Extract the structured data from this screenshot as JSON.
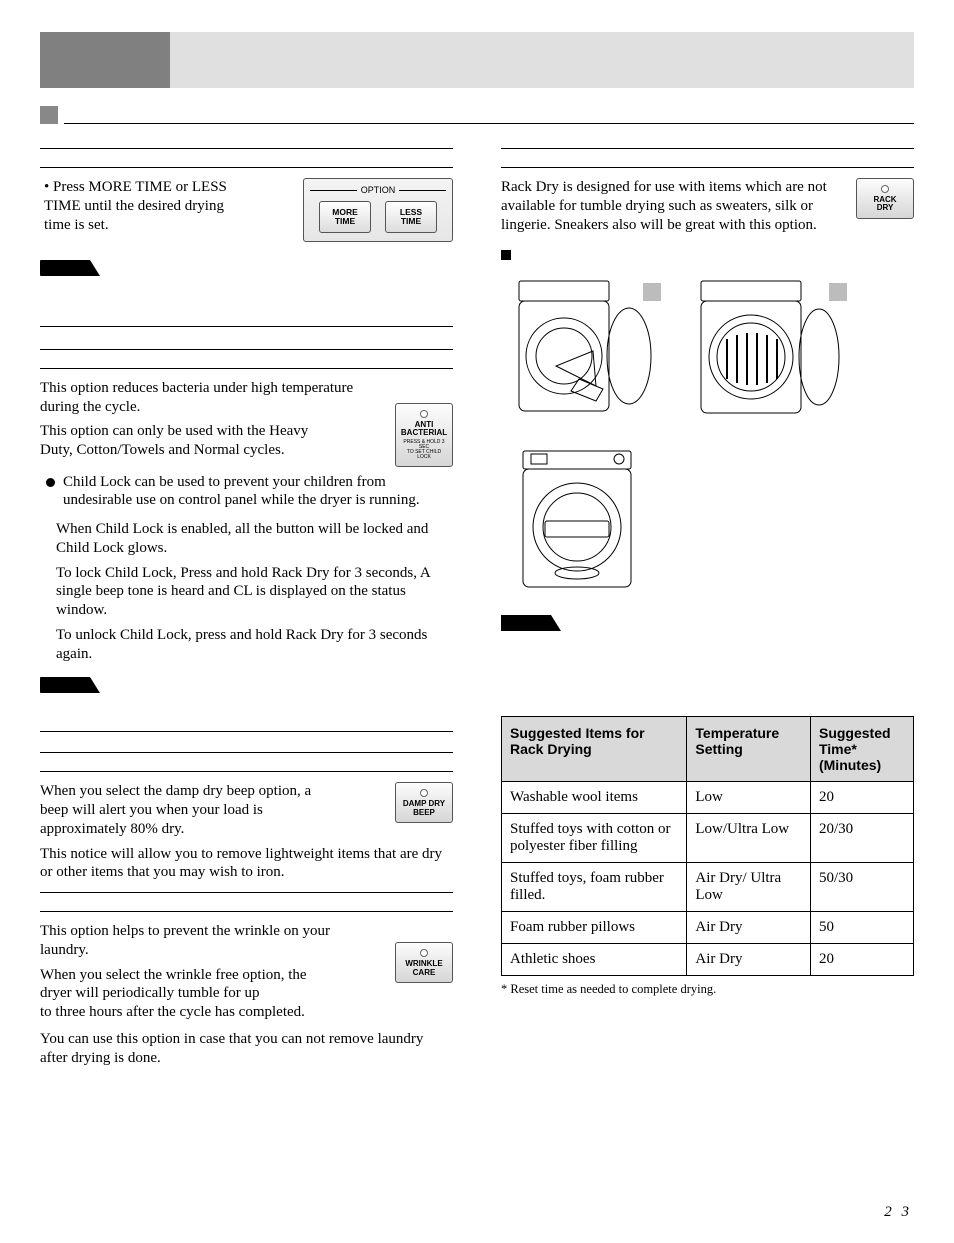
{
  "panel": {
    "option_label": "OPTION",
    "more_time": "MORE\nTIME",
    "less_time": "LESS\nTIME"
  },
  "left": {
    "time_set": "• Press MORE TIME or LESS TIME until the desired drying time is set.",
    "anti1": "This option reduces bacteria under high temperature during the cycle.",
    "anti2": "This option can only be used with the Heavy Duty, Cotton/Towels and Normal cycles.",
    "anti_btn1": "ANTI",
    "anti_btn2": "BACTERIAL",
    "anti_btn_tiny": "PRESS & HOLD 3 SEC\nTO SET CHILD LOCK",
    "child1": "Child Lock can be used to prevent your children from undesirable use on control panel while the dryer is running.",
    "child2": "When Child Lock is enabled, all the button will be locked and Child Lock glows.",
    "child3": "To lock Child Lock, Press and hold Rack Dry for 3 seconds, A single beep tone is heard and CL is displayed on the status window.",
    "child4": "To unlock Child Lock, press and hold Rack Dry for 3 seconds again.",
    "damp1": "When you select the damp dry beep option, a beep will alert you when your load is approximately 80% dry.",
    "damp2": "This notice will allow you to remove lightweight items that are dry or other items that you may wish to iron.",
    "damp_btn1": "DAMP DRY",
    "damp_btn2": "BEEP",
    "wrinkle1": "This option helps to prevent the wrinkle on your laundry.",
    "wrinkle2": "When you select the wrinkle free option, the dryer will periodically tumble for up to three hours after the cycle has completed.",
    "wrinkle3": "You can use this option in case that you can not remove laundry after drying is done.",
    "wrinkle_btn1": "WRINKLE",
    "wrinkle_btn2": "CARE"
  },
  "right": {
    "rack1": "Rack Dry is designed for use with items which are not available for tumble drying such as sweaters, silk or lingerie. Sneakers also will be great with this option.",
    "rack_btn1": "RACK",
    "rack_btn2": "DRY"
  },
  "table": {
    "h1": "Suggested Items for Rack Drying",
    "h2": "Temperature Setting",
    "h3": "Suggested Time* (Minutes)",
    "rows": [
      {
        "a": "Washable wool items",
        "b": "Low",
        "c": "20"
      },
      {
        "a": "Stuffed toys with cotton or polyester fiber filling",
        "b": "Low/Ultra Low",
        "c": "20/30"
      },
      {
        "a": "Stuffed toys, foam rubber filled.",
        "b": "Air Dry/ Ultra Low",
        "c": "50/30"
      },
      {
        "a": "Foam rubber pillows",
        "b": "Air Dry",
        "c": "50"
      },
      {
        "a": "Athletic shoes",
        "b": "Air Dry",
        "c": "20"
      }
    ]
  },
  "footnote": "* Reset time as needed to complete drying.",
  "page": "2 3"
}
